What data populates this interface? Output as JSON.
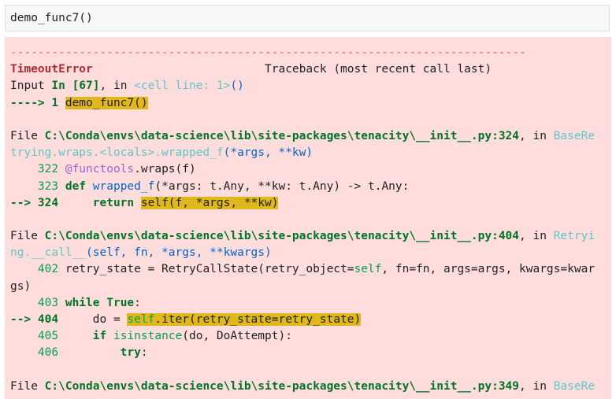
{
  "input_cell": {
    "code": "demo_func7()"
  },
  "traceback": {
    "separator": "---------------------------------------------------------------------------",
    "error_type": "TimeoutError",
    "header_gap": "                         ",
    "header_right": "Traceback (most recent call last)",
    "input_prefix": "Input ",
    "input_in": "In [67]",
    "input_comma": ", in ",
    "input_cell_line": "<cell line: 1>",
    "input_parens": "()",
    "arrow1": "----> 1 ",
    "arrow1_code": "demo_func7()",
    "frame1": {
      "file_prefix": "File ",
      "file_path": "C:\\Conda\\envs\\data-science\\lib\\site-packages\\tenacity\\__init__.py:324",
      "in_text": ", in ",
      "func_a": "BaseRe",
      "func_b": "trying.wraps.<locals>.wrapped_f",
      "args_b": "(*args, **kw)",
      "l322_num": "    322 ",
      "l322_deco": "@functools",
      "l322_rest": ".wraps(f)",
      "l323_num": "    323 ",
      "l323_def": "def",
      "l323_name": " wrapped_f",
      "l323_rest": "(*args: t.Any, **kw: t.Any) -> t.Any:",
      "l324_arrow": "--> 324 ",
      "l324_ret": "    return ",
      "l324_code": "self(f, *args, **kw)"
    },
    "frame2": {
      "file_prefix": "File ",
      "file_path": "C:\\Conda\\envs\\data-science\\lib\\site-packages\\tenacity\\__init__.py:404",
      "in_text": ", in ",
      "func_a": "Retryi",
      "func_b": "ng.__call__",
      "args_b": "(self, fn, *args, **kwargs)",
      "l402_num": "    402 ",
      "l402_code_a": "retry_state = RetryCallState(retry_object=",
      "l402_self": "self",
      "l402_code_b": ", fn=fn, args=args, kwargs=kwar",
      "l402_wrap": "gs)",
      "l403_num": "    403 ",
      "l403_while": "while",
      "l403_true": " True",
      "l403_colon": ":",
      "l404_arrow": "--> 404 ",
      "l404_indent": "    do = ",
      "l404_self": "self",
      "l404_code": ".iter(retry_state=retry_state)",
      "l405_num": "    405 ",
      "l405_if": "    if",
      "l405_isinst": " isinstance",
      "l405_rest": "(do, DoAttempt):",
      "l406_num": "    406 ",
      "l406_try": "        try",
      "l406_colon": ":"
    },
    "frame3": {
      "file_prefix": "File ",
      "file_path": "C:\\Conda\\envs\\data-science\\lib\\site-packages\\tenacity\\__init__.py:349",
      "in_text": ", in ",
      "func_a": "BaseRe"
    }
  }
}
